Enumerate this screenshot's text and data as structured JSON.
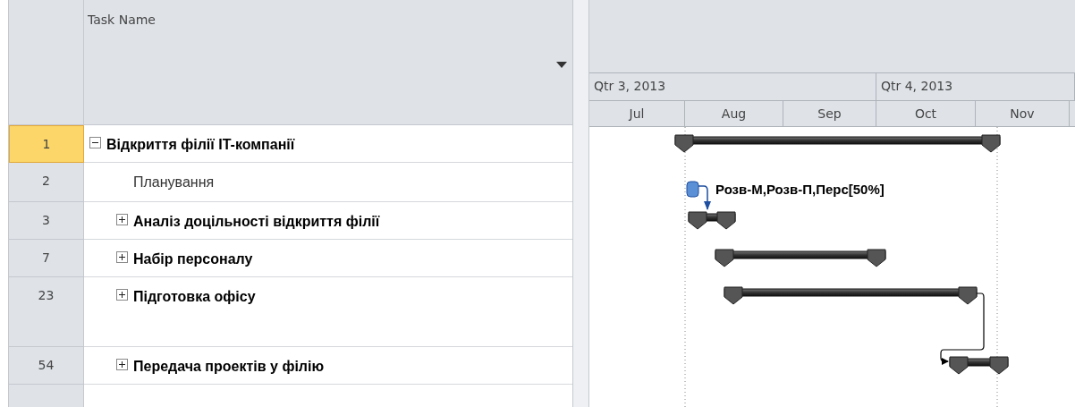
{
  "columns": {
    "task_name": "Task Name"
  },
  "timescale": {
    "quarters": [
      "Qtr 3, 2013",
      "Qtr 4, 2013"
    ],
    "months": [
      "Jul",
      "Aug",
      "Sep",
      "Oct",
      "Nov"
    ]
  },
  "tasks": [
    {
      "id": "1",
      "name": "Відкриття філії IT-компанії",
      "kind": "summary",
      "expanded": true,
      "selected": true,
      "children": [
        {
          "id": "2",
          "name": "Планування",
          "kind": "task",
          "selected": false,
          "resources": "Розв-М,Розв-П,Перс[50%]"
        },
        {
          "id": "3",
          "name": "Аналіз доцільності відкриття філії",
          "kind": "summary",
          "expanded": false,
          "selected": false
        },
        {
          "id": "7",
          "name": "Набір персоналу",
          "kind": "summary",
          "expanded": false,
          "selected": false
        },
        {
          "id": "23",
          "name": "Підготовка офісу",
          "kind": "summary",
          "expanded": false,
          "selected": false
        },
        {
          "id": "54",
          "name": "Передача проектів у філію",
          "kind": "summary",
          "expanded": false,
          "selected": false
        }
      ]
    }
  ]
}
